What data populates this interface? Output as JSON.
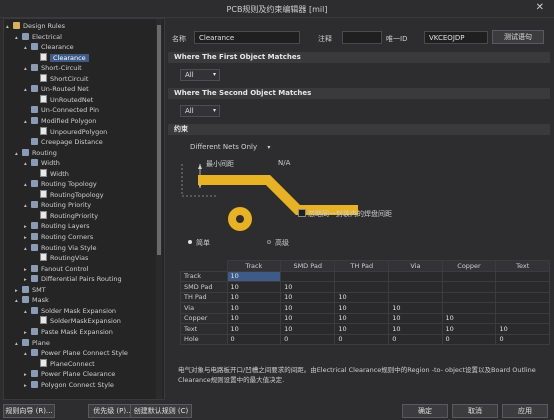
{
  "window": {
    "title": "PCB规则及约束编辑器 [mil]",
    "close": "✕"
  },
  "tree": [
    {
      "label": "Design Rules",
      "depth": 0,
      "arrow": "▴",
      "icon": "folder"
    },
    {
      "label": "Electrical",
      "depth": 1,
      "arrow": "▴",
      "icon": "cat"
    },
    {
      "label": "Clearance",
      "depth": 2,
      "arrow": "▴",
      "icon": "cat"
    },
    {
      "label": "Clearance",
      "depth": 3,
      "arrow": "",
      "icon": "rule",
      "selected": true
    },
    {
      "label": "Short-Circuit",
      "depth": 2,
      "arrow": "▴",
      "icon": "cat"
    },
    {
      "label": "ShortCircuit",
      "depth": 3,
      "arrow": "",
      "icon": "rule"
    },
    {
      "label": "Un-Routed Net",
      "depth": 2,
      "arrow": "▴",
      "icon": "cat"
    },
    {
      "label": "UnRoutedNet",
      "depth": 3,
      "arrow": "",
      "icon": "rule"
    },
    {
      "label": "Un-Connected Pin",
      "depth": 2,
      "arrow": "",
      "icon": "cat"
    },
    {
      "label": "Modified Polygon",
      "depth": 2,
      "arrow": "▴",
      "icon": "cat"
    },
    {
      "label": "UnpouredPolygon",
      "depth": 3,
      "arrow": "",
      "icon": "rule"
    },
    {
      "label": "Creepage Distance",
      "depth": 2,
      "arrow": "",
      "icon": "cat"
    },
    {
      "label": "Routing",
      "depth": 1,
      "arrow": "▴",
      "icon": "cat"
    },
    {
      "label": "Width",
      "depth": 2,
      "arrow": "▴",
      "icon": "cat"
    },
    {
      "label": "Width",
      "depth": 3,
      "arrow": "",
      "icon": "rule"
    },
    {
      "label": "Routing Topology",
      "depth": 2,
      "arrow": "▴",
      "icon": "cat"
    },
    {
      "label": "RoutingTopology",
      "depth": 3,
      "arrow": "",
      "icon": "rule"
    },
    {
      "label": "Routing Priority",
      "depth": 2,
      "arrow": "▴",
      "icon": "cat"
    },
    {
      "label": "RoutingPriority",
      "depth": 3,
      "arrow": "",
      "icon": "rule"
    },
    {
      "label": "Routing Layers",
      "depth": 2,
      "arrow": "▸",
      "icon": "cat"
    },
    {
      "label": "Routing Corners",
      "depth": 2,
      "arrow": "▸",
      "icon": "cat"
    },
    {
      "label": "Routing Via Style",
      "depth": 2,
      "arrow": "▴",
      "icon": "cat"
    },
    {
      "label": "RoutingVias",
      "depth": 3,
      "arrow": "",
      "icon": "rule"
    },
    {
      "label": "Fanout Control",
      "depth": 2,
      "arrow": "▸",
      "icon": "cat"
    },
    {
      "label": "Differential Pairs Routing",
      "depth": 2,
      "arrow": "▸",
      "icon": "cat"
    },
    {
      "label": "SMT",
      "depth": 1,
      "arrow": "▸",
      "icon": "cat"
    },
    {
      "label": "Mask",
      "depth": 1,
      "arrow": "▴",
      "icon": "cat"
    },
    {
      "label": "Solder Mask Expansion",
      "depth": 2,
      "arrow": "▴",
      "icon": "cat"
    },
    {
      "label": "SolderMaskExpansion",
      "depth": 3,
      "arrow": "",
      "icon": "rule"
    },
    {
      "label": "Paste Mask Expansion",
      "depth": 2,
      "arrow": "▸",
      "icon": "cat"
    },
    {
      "label": "Plane",
      "depth": 1,
      "arrow": "▴",
      "icon": "cat"
    },
    {
      "label": "Power Plane Connect Style",
      "depth": 2,
      "arrow": "▴",
      "icon": "cat"
    },
    {
      "label": "PlaneConnect",
      "depth": 3,
      "arrow": "",
      "icon": "rule"
    },
    {
      "label": "Power Plane Clearance",
      "depth": 2,
      "arrow": "▸",
      "icon": "cat"
    },
    {
      "label": "Polygon Connect Style",
      "depth": 2,
      "arrow": "▸",
      "icon": "cat"
    }
  ],
  "header": {
    "name_label": "名称",
    "name_value": "Clearance",
    "comment_label": "注释",
    "comment_value": "",
    "uid_label": "唯一ID",
    "uid_value": "VKCEOJDP",
    "test_button": "测试语句"
  },
  "first_match": {
    "title": "Where The First Object Matches",
    "value": "All"
  },
  "second_match": {
    "title": "Where The Second Object Matches",
    "value": "All"
  },
  "constraints": {
    "title": "约束",
    "net_scope": "Different Nets Only",
    "min_clearance_label": "最小间距",
    "min_clearance_value": "N/A",
    "ignore_pads_label": "忽略同一封装内的焊盘间距",
    "mode_simple": "简单",
    "mode_advanced": "高级"
  },
  "grid": {
    "columns": [
      "Track",
      "SMD Pad",
      "TH Pad",
      "Via",
      "Copper",
      "Text"
    ],
    "rows": [
      {
        "name": "Track",
        "values": [
          "10",
          "",
          "",
          "",
          "",
          ""
        ]
      },
      {
        "name": "SMD Pad",
        "values": [
          "10",
          "10",
          "",
          "",
          "",
          ""
        ]
      },
      {
        "name": "TH Pad",
        "values": [
          "10",
          "10",
          "10",
          "",
          "",
          ""
        ]
      },
      {
        "name": "Via",
        "values": [
          "10",
          "10",
          "10",
          "10",
          "",
          ""
        ]
      },
      {
        "name": "Copper",
        "values": [
          "10",
          "10",
          "10",
          "10",
          "10",
          ""
        ]
      },
      {
        "name": "Text",
        "values": [
          "10",
          "10",
          "10",
          "10",
          "10",
          "10"
        ]
      },
      {
        "name": "Hole",
        "values": [
          "0",
          "0",
          "0",
          "0",
          "0",
          "0"
        ]
      }
    ]
  },
  "description": "电气对象与电路板开口/凹槽之间要求的间距。由Electrical Clearance规则中的Region -to- object设置以及Board Outline Clearance规则设置中的最大值决定.",
  "footer": {
    "wizard": "规则向导 (R)...",
    "priority": "优先级 (P)...",
    "default_rules": "创建默认规则 (C)",
    "ok": "确定",
    "cancel": "取消",
    "apply": "应用"
  }
}
